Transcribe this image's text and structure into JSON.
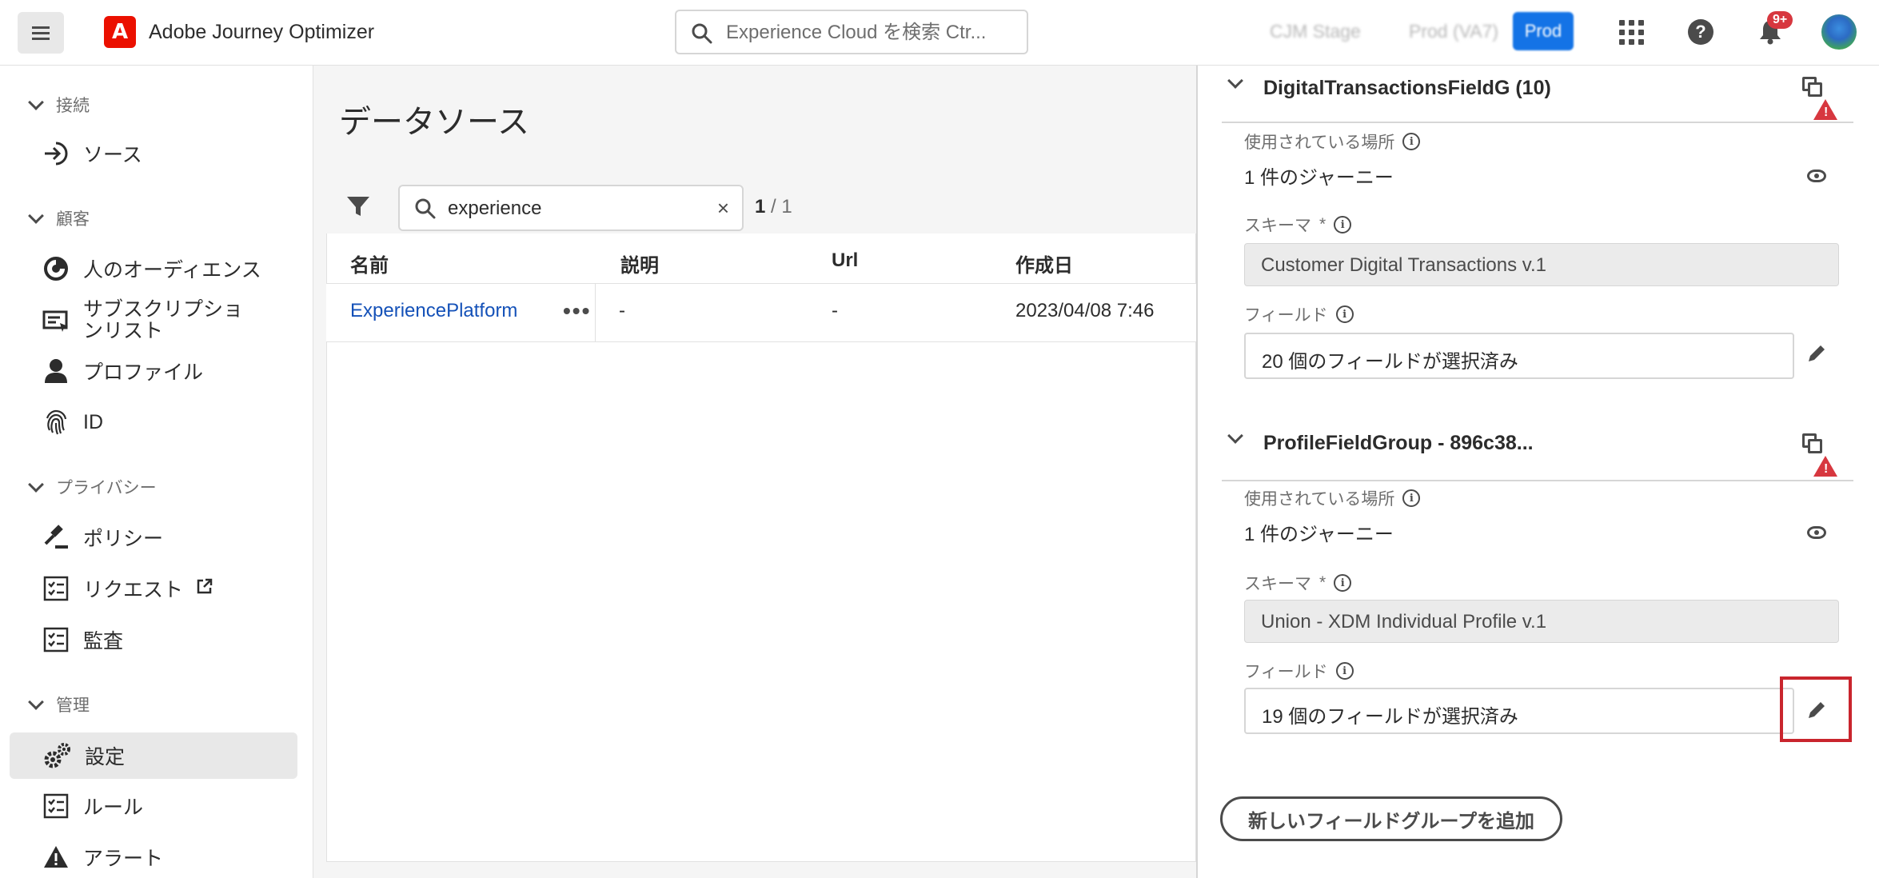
{
  "app": {
    "title": "Adobe Journey Optimizer",
    "logo_letter": "A"
  },
  "topbar": {
    "search_placeholder": "Experience Cloud を検索 Ctr...",
    "env1": "CJM Stage",
    "env2": "Prod (VA7)",
    "env_active": "Prod",
    "notification_count": "9+"
  },
  "nav": {
    "section_connections": "接続",
    "item_sources": "ソース",
    "section_customers": "顧客",
    "item_audiences": "人のオーディエンス",
    "item_subscription_line1": "サブスクリプショ",
    "item_subscription_line2": "ンリスト",
    "item_profiles": "プロファイル",
    "item_id": "ID",
    "section_privacy": "プライバシー",
    "item_policies": "ポリシー",
    "item_requests": "リクエスト",
    "item_audit": "監査",
    "section_admin": "管理",
    "item_settings": "設定",
    "item_rules": "ルール",
    "item_alerts": "アラート"
  },
  "main": {
    "title": "データソース",
    "search_value": "experience",
    "count_current": "1",
    "count_total": "/ 1",
    "columns": {
      "name": "名前",
      "description": "説明",
      "url": "Url",
      "created": "作成日"
    },
    "rows": [
      {
        "name": "ExperiencePlatform",
        "description": "-",
        "url": "-",
        "created": "2023/04/08 7:46"
      }
    ]
  },
  "panel": {
    "group1": {
      "title": "DigitalTransactionsFieldG (10)",
      "used_in_label": "使用されている場所",
      "used_in_value": "1 件のジャーニー",
      "schema_label": "スキーマ",
      "schema_value": "Customer Digital Transactions  v.1",
      "fields_label": "フィールド",
      "fields_value": "20 個のフィールドが選択済み"
    },
    "group2": {
      "title": "ProfileFieldGroup - 896c38...",
      "used_in_label": "使用されている場所",
      "used_in_value": "1 件のジャーニー",
      "schema_label": "スキーマ",
      "schema_value": "Union - XDM Individual Profile v.1",
      "fields_label": "フィールド",
      "fields_value": "19 個のフィールドが選択済み"
    },
    "required_mark": "*",
    "add_button": "新しいフィールドグループを追加"
  },
  "colors": {
    "accent": "#1473e6",
    "brand": "#eb1000",
    "highlight": "#c9252d",
    "link": "#1451b8"
  }
}
